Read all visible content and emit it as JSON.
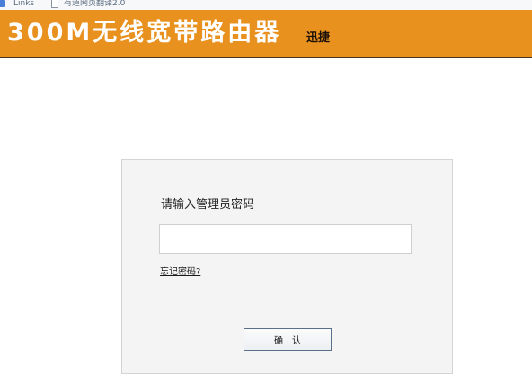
{
  "bookmarks_bar": {
    "items": [
      {
        "label": "Links",
        "icon": "folder-icon"
      },
      {
        "label": "有道网页翻译2.0",
        "icon": "page-icon"
      }
    ]
  },
  "header": {
    "title": "300M无线宽带路由器",
    "brand": "迅捷",
    "background_color": "#e8911f"
  },
  "login": {
    "label": "请输入管理员密码",
    "password_value": "",
    "forgot_link": "忘记密码?",
    "confirm_button": "确认"
  }
}
